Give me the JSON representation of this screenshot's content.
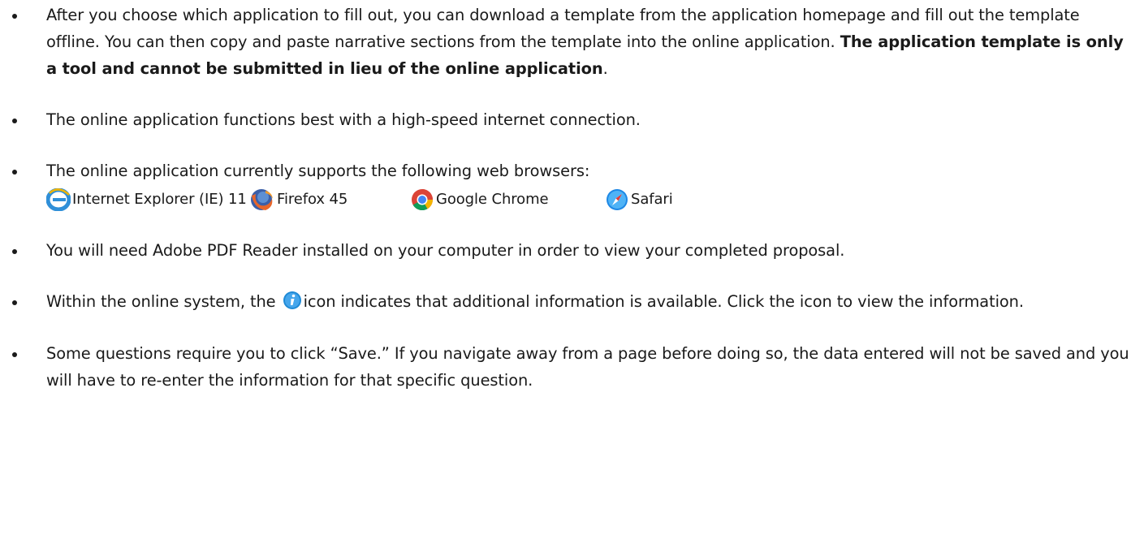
{
  "bullets": {
    "b1": {
      "text_before": "After you choose which application to fill out, you can download a template from the application homepage and fill out the template offline. You can then copy and paste narrative sections from the template into the online application. ",
      "bold": "The application template is only a tool and cannot be submitted in lieu of the online application",
      "text_after": "."
    },
    "b2": {
      "text": "The online application functions best with a high-speed internet connection."
    },
    "b3": {
      "text": "The online application currently supports the following web browsers:",
      "browsers": [
        {
          "icon": "internet-explorer-icon",
          "label": "Internet Explorer (IE) 11"
        },
        {
          "icon": "firefox-icon",
          "label": "Firefox 45"
        },
        {
          "icon": "google-chrome-icon",
          "label": "Google Chrome"
        },
        {
          "icon": "safari-icon",
          "label": "Safari"
        }
      ]
    },
    "b4": {
      "text": "You will need Adobe PDF Reader installed on your computer in order to view your completed proposal."
    },
    "b5": {
      "text_before": "Within the online system, the ",
      "icon": "info-icon",
      "text_after": "icon indicates that additional information is available. Click the icon to view the information."
    },
    "b6": {
      "text": "Some questions require you to click “Save.” If you navigate away from a page before doing so, the data entered will not be saved and you will have to re-enter the information for that specific question."
    }
  },
  "colors": {
    "text": "#1a1a1a",
    "info_icon": "#1f8ad6",
    "ie_blue": "#2f8fd8",
    "firefox_orange": "#e8662a",
    "chrome_red": "#db4437",
    "chrome_green": "#0f9d58",
    "chrome_yellow": "#f4b400",
    "safari_blue": "#1e88e5"
  }
}
